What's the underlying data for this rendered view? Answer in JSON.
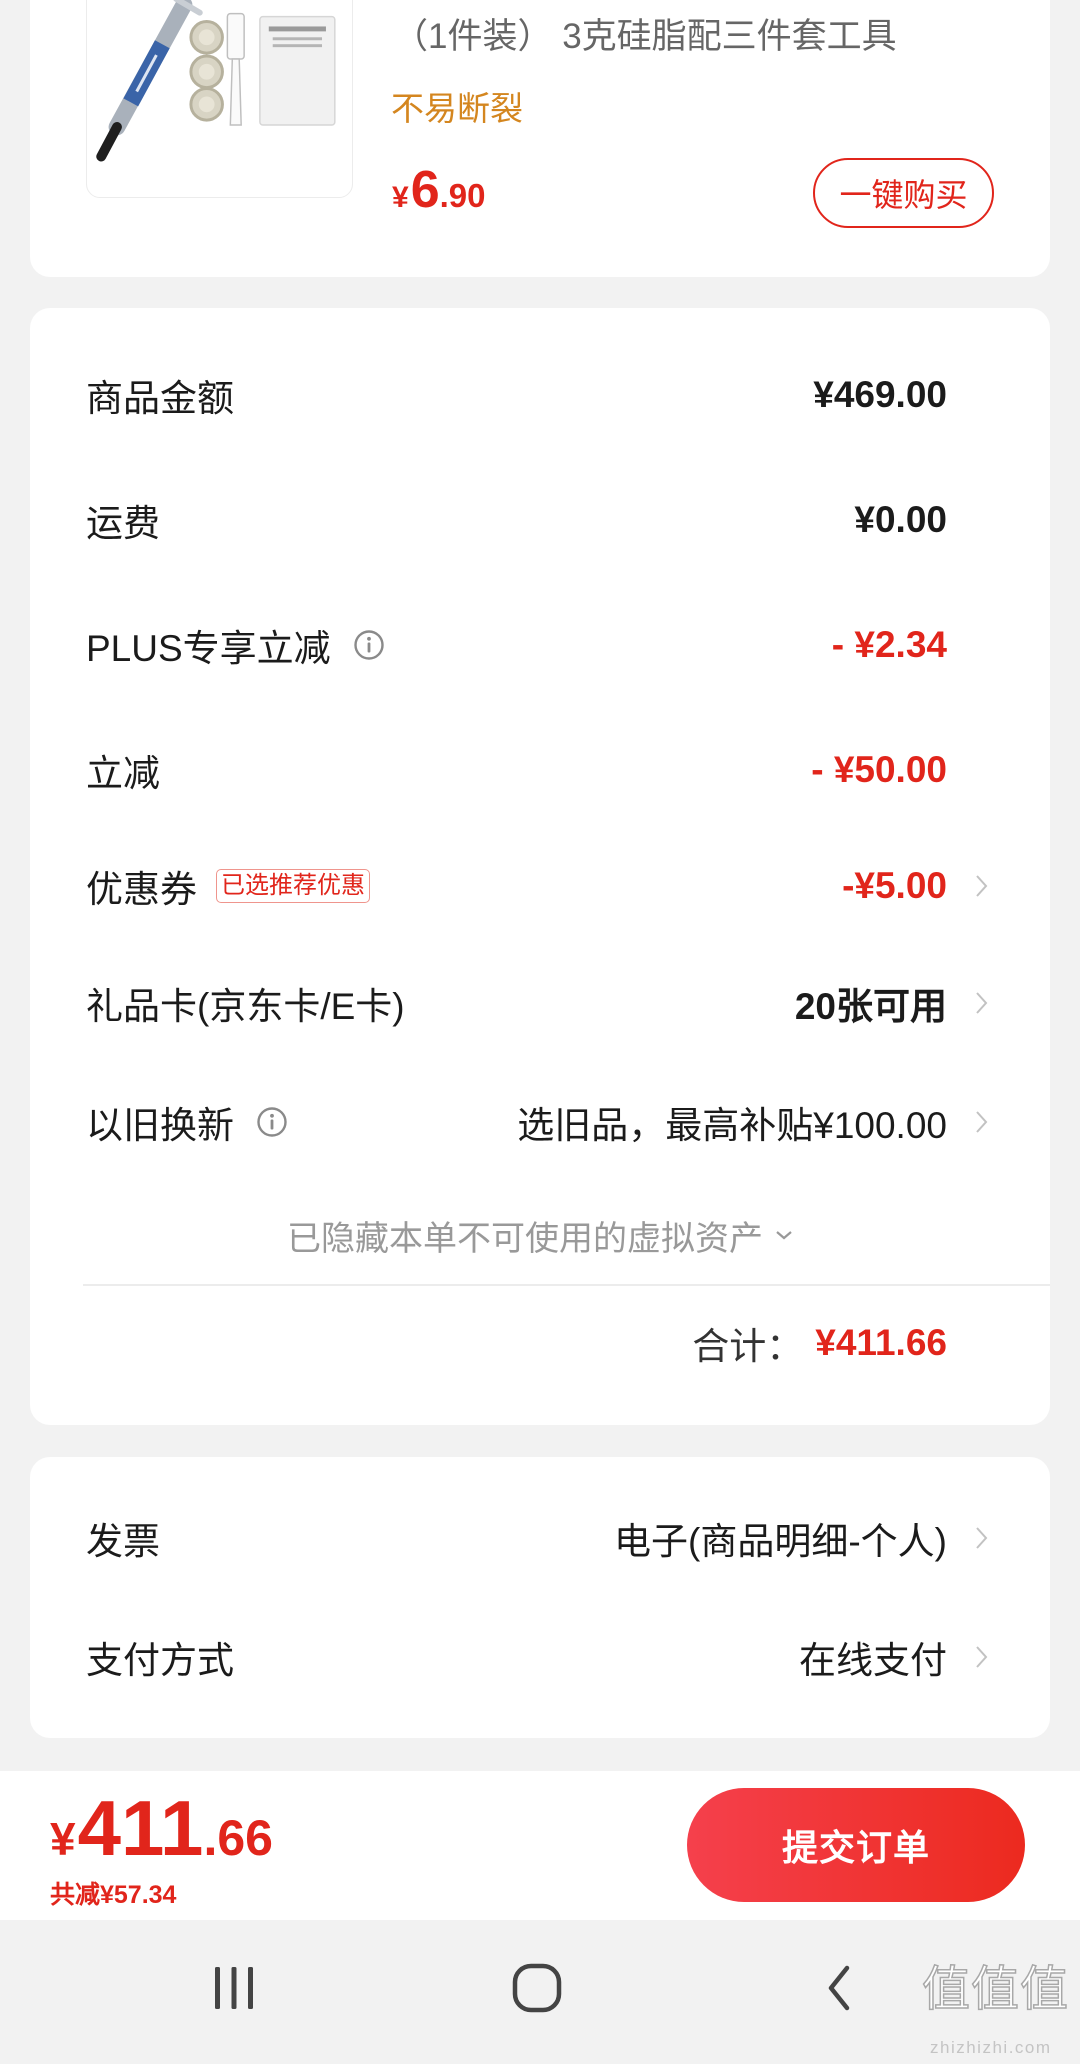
{
  "product": {
    "title": "（1件装） 3克硅脂配三件套工具",
    "tag": "不易断裂",
    "price": {
      "symbol": "¥",
      "integer": "6",
      "decimal": ".90"
    },
    "buy_button": "一键购买",
    "image_icon": "thermal-paste-kit-image"
  },
  "summary": {
    "rows": [
      {
        "label": "商品金额",
        "value": "¥469.00"
      },
      {
        "label": "运费",
        "value": "¥0.00"
      },
      {
        "label": "PLUS专享立减",
        "value": "- ¥2.34",
        "icons": [
          "info-icon"
        ]
      },
      {
        "label": "立减",
        "value": "- ¥50.00"
      },
      {
        "label": "优惠券",
        "badge": "已选推荐优惠",
        "value": "-¥5.00",
        "icons": [
          "chevron-right-icon"
        ]
      },
      {
        "label": "礼品卡(京东卡/E卡)",
        "value": "20张可用",
        "icons": [
          "chevron-right-icon"
        ]
      },
      {
        "label": "以旧换新",
        "value": "选旧品，最高补贴¥100.00",
        "icons": [
          "info-icon",
          "chevron-right-icon"
        ]
      }
    ],
    "hidden_assets": {
      "text": "已隐藏本单不可使用的虚拟资产",
      "icon": "chevron-down-icon"
    },
    "total": {
      "label": "合计：",
      "value": "¥411.66"
    }
  },
  "options": [
    {
      "label": "发票",
      "value": "电子(商品明细-个人)",
      "icon": "chevron-right-icon"
    },
    {
      "label": "支付方式",
      "value": "在线支付",
      "icon": "chevron-right-icon"
    }
  ],
  "checkout_bar": {
    "currency": "¥",
    "amount_integer": "411",
    "amount_decimal": ".66",
    "total_saved": "共减¥57.34",
    "submit_button": "提交订单"
  },
  "system_nav": {
    "recents_icon": "recent-apps-icon",
    "home_icon": "home-icon",
    "back_icon": "back-icon"
  },
  "watermark": {
    "logo": "值值值",
    "site": "zhizhizhi.com"
  },
  "colors": {
    "accent_red": "#e1251b",
    "tag_orange": "#d4861f",
    "page_background": "#f2f2f2",
    "card_background": "#ffffff",
    "button_gradient_start": "#f5404c",
    "button_gradient_end": "#ec2a1f"
  }
}
